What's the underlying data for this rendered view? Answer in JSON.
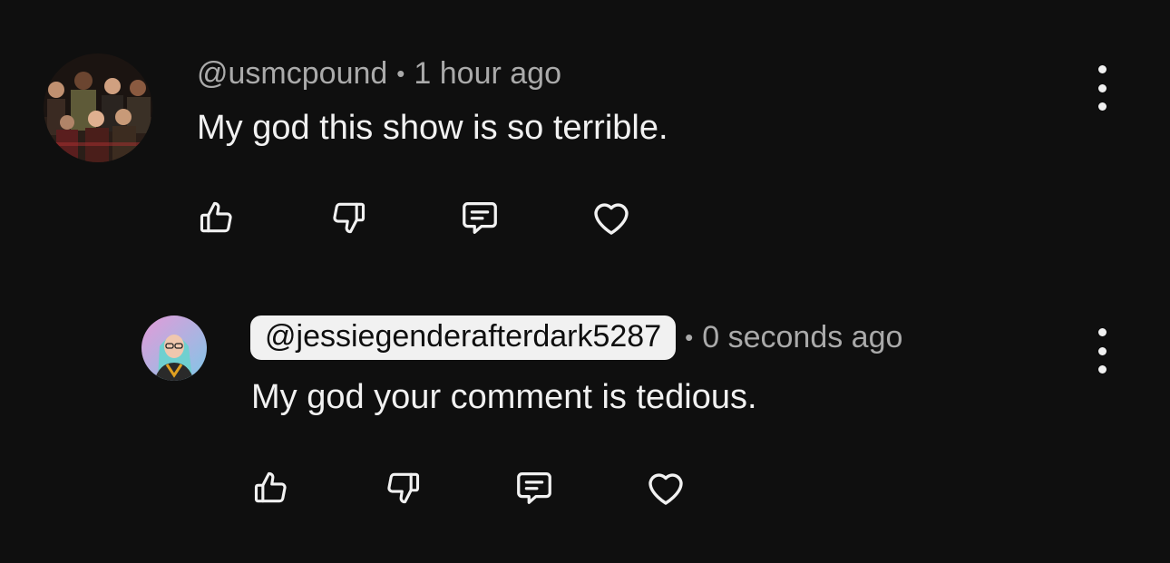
{
  "comments": [
    {
      "author": "@usmcpound",
      "separator": "•",
      "time": "1 hour ago",
      "text": "My god this show is so terrible.",
      "avatar": "group-photo-avatar",
      "actions": [
        "like-icon",
        "dislike-icon",
        "reply-icon",
        "heart-icon"
      ],
      "menu_icon": "more-vert-icon"
    },
    {
      "author": "@jessiegenderafterdark5287",
      "author_highlighted": true,
      "separator": "•",
      "time": "0 seconds ago",
      "text": "My god your comment is tedious.",
      "avatar": "user-photo-avatar",
      "actions": [
        "like-icon",
        "dislike-icon",
        "reply-icon",
        "heart-icon"
      ],
      "menu_icon": "more-vert-icon"
    }
  ],
  "colors": {
    "background": "#0f0f0f",
    "text_primary": "#f1f1f1",
    "text_secondary": "#aaaaaa",
    "highlight_bg": "#f1f1f1"
  }
}
